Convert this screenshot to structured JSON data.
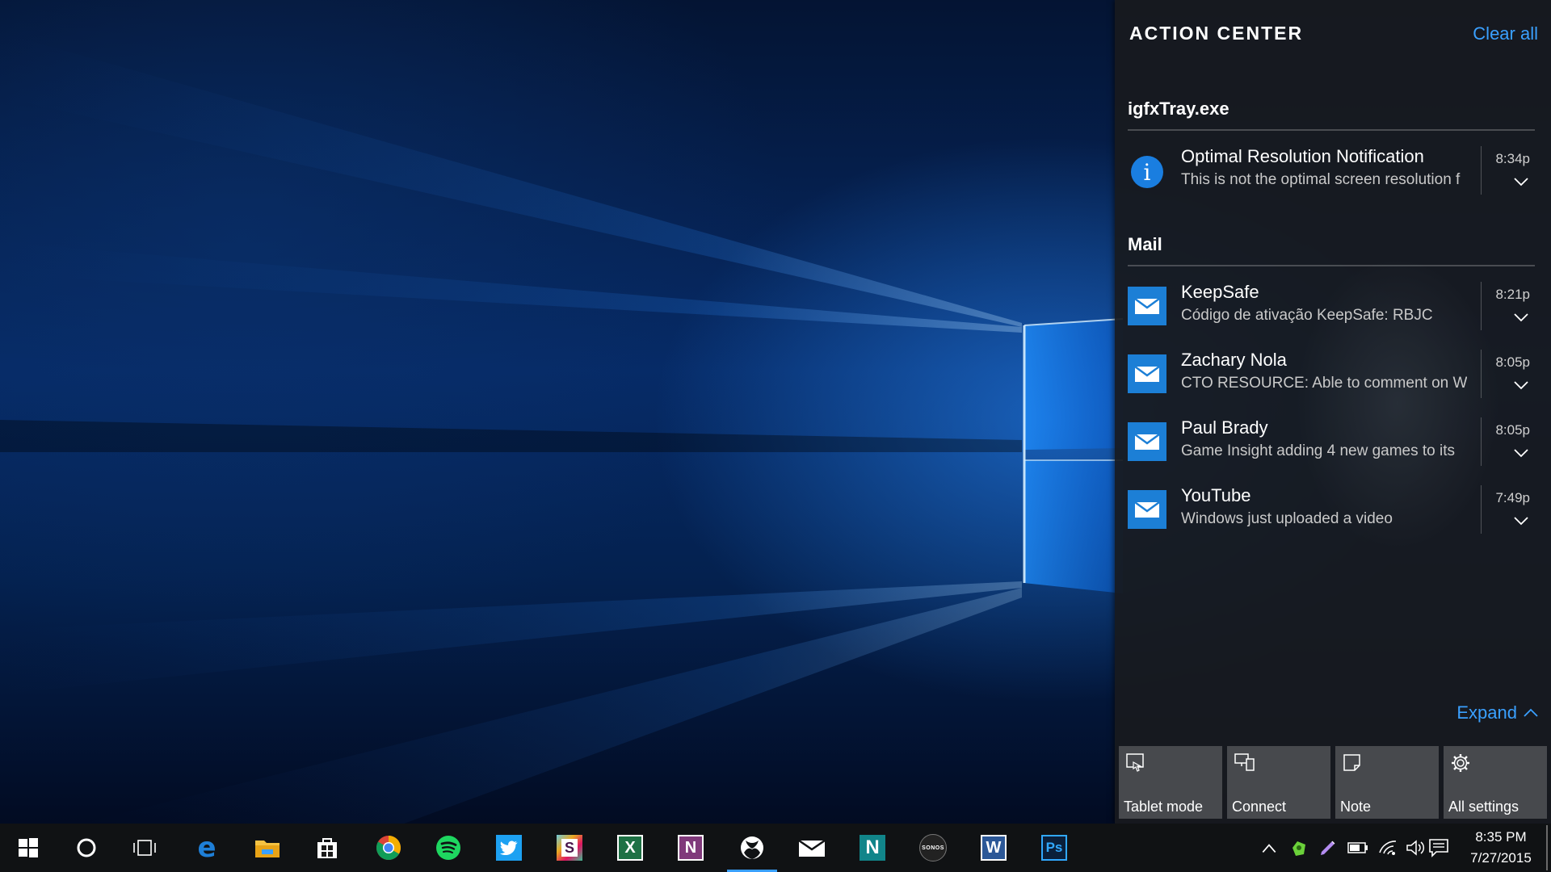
{
  "action_center": {
    "title": "ACTION CENTER",
    "clear_all": "Clear all",
    "groups": [
      {
        "name": "igfxTray.exe",
        "notifications": [
          {
            "icon": "info-icon",
            "title": "Optimal Resolution Notification",
            "body": "This is not the optimal screen resolution f",
            "time": "8:34p"
          }
        ]
      },
      {
        "name": "Mail",
        "notifications": [
          {
            "icon": "mail-icon",
            "title": "KeepSafe",
            "body": "Código de ativação KeepSafe: RBJC",
            "time": "8:21p"
          },
          {
            "icon": "mail-icon",
            "title": "Zachary Nola",
            "body": "CTO RESOURCE: Able to comment on Wi",
            "time": "8:05p"
          },
          {
            "icon": "mail-icon",
            "title": "Paul Brady",
            "body": "Game Insight adding 4 new games to its",
            "time": "8:05p"
          },
          {
            "icon": "mail-icon",
            "title": "YouTube",
            "body": "Windows just uploaded a video",
            "time": "7:49p"
          }
        ]
      }
    ],
    "expand": "Expand",
    "quick_actions": [
      {
        "icon": "tablet-mode-icon",
        "label": "Tablet mode"
      },
      {
        "icon": "connect-icon",
        "label": "Connect"
      },
      {
        "icon": "note-icon",
        "label": "Note"
      },
      {
        "icon": "gear-icon",
        "label": "All settings"
      }
    ]
  },
  "taskbar": {
    "apps": [
      {
        "name": "start-button",
        "icon": "windows-logo-icon"
      },
      {
        "name": "cortana-button",
        "icon": "cortana-circle-icon"
      },
      {
        "name": "task-view-button",
        "icon": "task-view-icon"
      },
      {
        "name": "taskbar-edge",
        "icon": "edge-icon",
        "letter": "e",
        "color": "#1e7fd8"
      },
      {
        "name": "taskbar-file-explorer",
        "icon": "folder-icon",
        "color": "#f5c242"
      },
      {
        "name": "taskbar-store",
        "icon": "store-icon"
      },
      {
        "name": "taskbar-chrome",
        "icon": "chrome-icon"
      },
      {
        "name": "taskbar-spotify",
        "icon": "spotify-icon",
        "color": "#1ed760"
      },
      {
        "name": "taskbar-twitter",
        "icon": "twitter-icon",
        "color": "#1da1f2"
      },
      {
        "name": "taskbar-slack",
        "icon": "slack-icon",
        "letter": "S"
      },
      {
        "name": "taskbar-excel",
        "icon": "excel-icon",
        "letter": "X",
        "color": "#1e7145"
      },
      {
        "name": "taskbar-onenote",
        "icon": "onenote-icon",
        "letter": "N",
        "color": "#80397b"
      },
      {
        "name": "taskbar-xbox",
        "icon": "xbox-icon",
        "active": true
      },
      {
        "name": "taskbar-mail",
        "icon": "mail-icon"
      },
      {
        "name": "taskbar-nextgen-reader",
        "icon": "n-icon",
        "letter": "N",
        "color": "#11858a"
      },
      {
        "name": "taskbar-sonos",
        "icon": "sonos-icon",
        "letter": "SONOS"
      },
      {
        "name": "taskbar-word",
        "icon": "word-icon",
        "letter": "W",
        "color": "#2b5797"
      },
      {
        "name": "taskbar-photoshop",
        "icon": "photoshop-icon",
        "letter": "Ps",
        "color": "#0a1f3a"
      }
    ],
    "clock": {
      "time": "8:35 PM",
      "date": "7/27/2015"
    }
  }
}
